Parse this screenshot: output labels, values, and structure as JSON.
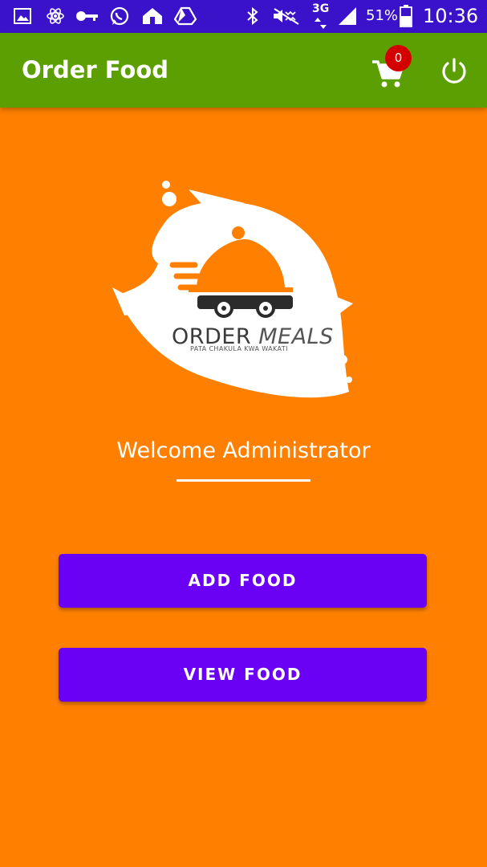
{
  "status_bar": {
    "battery_percent": "51%",
    "network": "3G",
    "time": "10:36",
    "left_icons": [
      "gallery-icon",
      "atom-icon",
      "key-icon",
      "whatsapp-icon",
      "home-shop-icon",
      "drive-icon"
    ],
    "right_icons": [
      "bluetooth-icon",
      "mute-icon",
      "signal-icon",
      "battery-icon"
    ]
  },
  "app_bar": {
    "title": "Order Food",
    "cart_count": "0",
    "color": "#5B9F02"
  },
  "logo": {
    "title_bold": "ORDER",
    "title_light": "MEALS",
    "tagline": "PATA CHAKULA KWA WAKATI"
  },
  "main": {
    "welcome_text": "Welcome Administrator",
    "background": "#FF8000",
    "buttons": {
      "add_food": "ADD FOOD",
      "view_food": "VIEW FOOD"
    },
    "button_color": "#6A00F4"
  }
}
